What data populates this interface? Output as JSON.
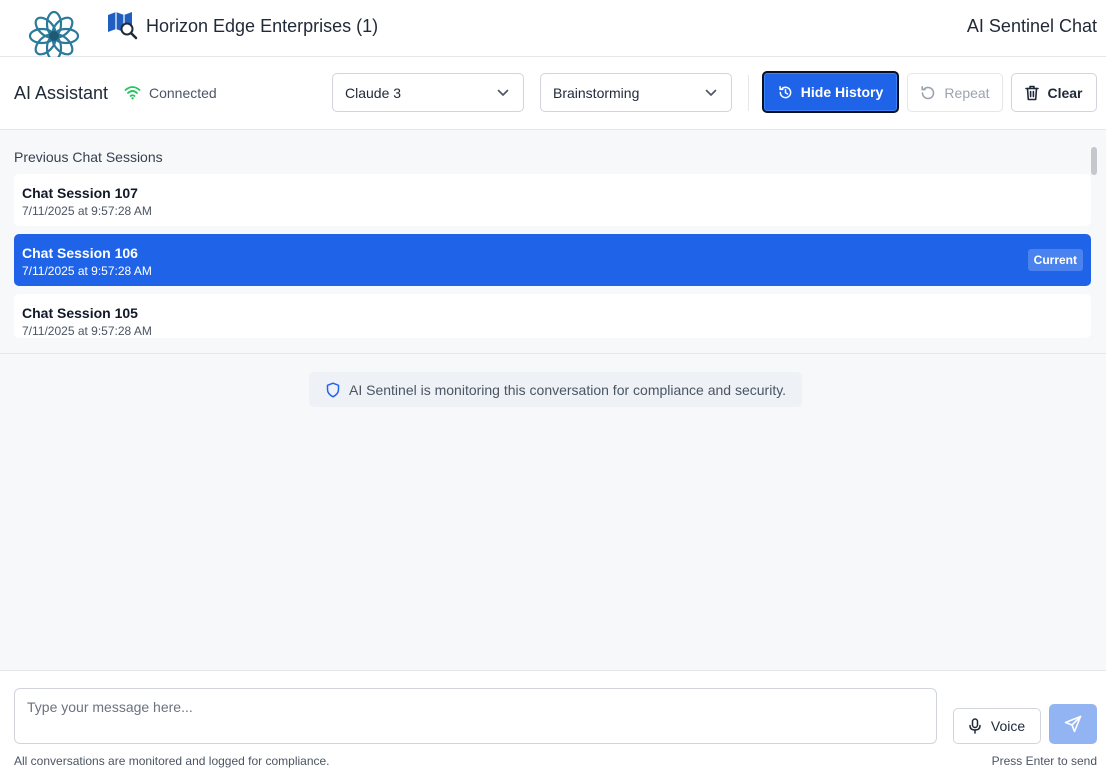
{
  "header": {
    "org_title": "Horizon Edge Enterprises (1)",
    "app_title": "AI Sentinel Chat"
  },
  "toolbar": {
    "assistant_title": "AI Assistant",
    "connection_status": "Connected",
    "model_select": {
      "value": "Claude 3"
    },
    "mode_select": {
      "value": "Brainstorming"
    },
    "hide_history_label": "Hide History",
    "repeat_label": "Repeat",
    "clear_label": "Clear"
  },
  "history": {
    "title": "Previous Chat Sessions",
    "sessions": [
      {
        "name": "Chat Session 107",
        "time": "7/11/2025 at 9:57:28 AM",
        "current": false
      },
      {
        "name": "Chat Session 106",
        "time": "7/11/2025 at 9:57:28 AM",
        "current": true,
        "badge": "Current"
      },
      {
        "name": "Chat Session 105",
        "time": "7/11/2025 at 9:57:28 AM",
        "current": false
      }
    ]
  },
  "chat": {
    "notice": "AI Sentinel is monitoring this conversation for compliance and security."
  },
  "input": {
    "placeholder": "Type your message here...",
    "voice_label": "Voice",
    "footnote_left": "All conversations are monitored and logged for compliance.",
    "footnote_right": "Press Enter to send"
  },
  "colors": {
    "primary": "#1f64e8",
    "connected": "#22c55e",
    "send_disabled": "#93b4f3"
  },
  "icons": {
    "logo": "flower-logo-icon",
    "org": "map-search-icon",
    "connection": "wifi-icon",
    "history": "history-icon",
    "repeat": "rotate-icon",
    "clear": "trash-icon",
    "notice": "shield-icon",
    "voice": "microphone-icon",
    "send": "send-icon"
  }
}
